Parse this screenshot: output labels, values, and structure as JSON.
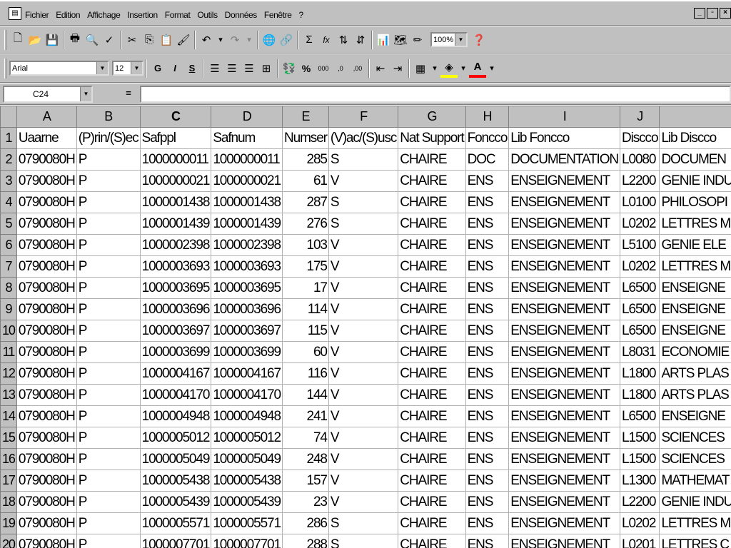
{
  "window": {
    "menus": [
      "Fichier",
      "Edition",
      "Affichage",
      "Insertion",
      "Format",
      "Outils",
      "Données",
      "Fenêtre",
      "?"
    ],
    "controls": [
      "_",
      "▫",
      "×"
    ]
  },
  "toolbar": {
    "zoom": "100%",
    "font_name": "Arial",
    "font_size": "12",
    "bold_label": "G",
    "italic_label": "I",
    "underline_label": "S",
    "percent_label": "%",
    "thousands_label": "000",
    "sum_label": "Σ",
    "function_label": "fx",
    "decimal_add_label": ",0",
    "decimal_remove_label": ",00"
  },
  "formula_bar": {
    "cell_ref": "C24",
    "equals": "=",
    "value": ""
  },
  "sheet": {
    "columns": [
      "A",
      "B",
      "C",
      "D",
      "E",
      "F",
      "G",
      "H",
      "I",
      "J",
      ""
    ],
    "active_column": "C",
    "header_row": [
      "Uaarne",
      "(P)rin/(S)ec",
      "Safppl",
      "Safnum",
      "Numser",
      "(V)ac/(S)usc",
      "Nat Support",
      "Foncco",
      "Lib Foncco",
      "Discco",
      "Lib Discco"
    ],
    "rows": [
      [
        "0790080H",
        "P",
        "1000000011",
        "1000000011",
        "285",
        "S",
        "CHAIRE",
        "DOC",
        "DOCUMENTATION",
        "L0080",
        "DOCUMEN"
      ],
      [
        "0790080H",
        "P",
        "1000000021",
        "1000000021",
        "61",
        "V",
        "CHAIRE",
        "ENS",
        "ENSEIGNEMENT",
        "L2200",
        "GENIE INDU"
      ],
      [
        "0790080H",
        "P",
        "1000001438",
        "1000001438",
        "287",
        "S",
        "CHAIRE",
        "ENS",
        "ENSEIGNEMENT",
        "L0100",
        "PHILOSOPI"
      ],
      [
        "0790080H",
        "P",
        "1000001439",
        "1000001439",
        "276",
        "S",
        "CHAIRE",
        "ENS",
        "ENSEIGNEMENT",
        "L0202",
        "LETTRES M"
      ],
      [
        "0790080H",
        "P",
        "1000002398",
        "1000002398",
        "103",
        "V",
        "CHAIRE",
        "ENS",
        "ENSEIGNEMENT",
        "L5100",
        "GENIE ELE"
      ],
      [
        "0790080H",
        "P",
        "1000003693",
        "1000003693",
        "175",
        "V",
        "CHAIRE",
        "ENS",
        "ENSEIGNEMENT",
        "L0202",
        "LETTRES M"
      ],
      [
        "0790080H",
        "P",
        "1000003695",
        "1000003695",
        "17",
        "V",
        "CHAIRE",
        "ENS",
        "ENSEIGNEMENT",
        "L6500",
        "ENSEIGNE"
      ],
      [
        "0790080H",
        "P",
        "1000003696",
        "1000003696",
        "114",
        "V",
        "CHAIRE",
        "ENS",
        "ENSEIGNEMENT",
        "L6500",
        "ENSEIGNE"
      ],
      [
        "0790080H",
        "P",
        "1000003697",
        "1000003697",
        "115",
        "V",
        "CHAIRE",
        "ENS",
        "ENSEIGNEMENT",
        "L6500",
        "ENSEIGNE"
      ],
      [
        "0790080H",
        "P",
        "1000003699",
        "1000003699",
        "60",
        "V",
        "CHAIRE",
        "ENS",
        "ENSEIGNEMENT",
        "L8031",
        "ECONOMIE"
      ],
      [
        "0790080H",
        "P",
        "1000004167",
        "1000004167",
        "116",
        "V",
        "CHAIRE",
        "ENS",
        "ENSEIGNEMENT",
        "L1800",
        "ARTS PLAS"
      ],
      [
        "0790080H",
        "P",
        "1000004170",
        "1000004170",
        "144",
        "V",
        "CHAIRE",
        "ENS",
        "ENSEIGNEMENT",
        "L1800",
        "ARTS PLAS"
      ],
      [
        "0790080H",
        "P",
        "1000004948",
        "1000004948",
        "241",
        "V",
        "CHAIRE",
        "ENS",
        "ENSEIGNEMENT",
        "L6500",
        "ENSEIGNE"
      ],
      [
        "0790080H",
        "P",
        "1000005012",
        "1000005012",
        "74",
        "V",
        "CHAIRE",
        "ENS",
        "ENSEIGNEMENT",
        "L1500",
        "SCIENCES"
      ],
      [
        "0790080H",
        "P",
        "1000005049",
        "1000005049",
        "248",
        "V",
        "CHAIRE",
        "ENS",
        "ENSEIGNEMENT",
        "L1500",
        "SCIENCES"
      ],
      [
        "0790080H",
        "P",
        "1000005438",
        "1000005438",
        "157",
        "V",
        "CHAIRE",
        "ENS",
        "ENSEIGNEMENT",
        "L1300",
        "MATHEMAT"
      ],
      [
        "0790080H",
        "P",
        "1000005439",
        "1000005439",
        "23",
        "V",
        "CHAIRE",
        "ENS",
        "ENSEIGNEMENT",
        "L2200",
        "GENIE INDU"
      ],
      [
        "0790080H",
        "P",
        "1000005571",
        "1000005571",
        "286",
        "S",
        "CHAIRE",
        "ENS",
        "ENSEIGNEMENT",
        "L0202",
        "LETTRES M"
      ],
      [
        "0790080H",
        "P",
        "1000007701",
        "1000007701",
        "288",
        "S",
        "CHAIRE",
        "ENS",
        "ENSEIGNEMENT",
        "L0201",
        "LETTRES C"
      ]
    ]
  }
}
